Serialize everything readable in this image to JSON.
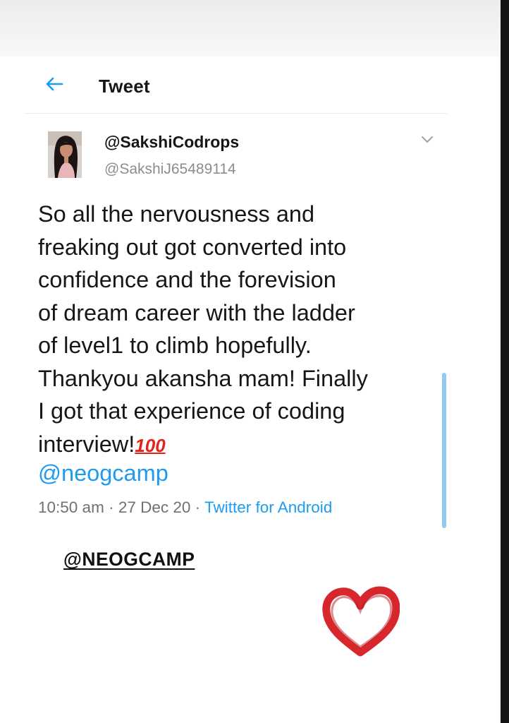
{
  "header": {
    "title": "Tweet"
  },
  "tweet": {
    "display_name": "@SakshiCodrops",
    "handle": "@SakshiJ65489114",
    "text_lines": [
      "So all the nervousness and",
      "freaking out got converted into",
      "confidence and the forevision",
      "of dream career with the ladder",
      "of level1 to climb hopefully.",
      "Thankyou akansha mam! Finally",
      "I got that experience of coding"
    ],
    "last_line": "interview!",
    "emoji": "💯",
    "emoji_text": "100",
    "mention": "@neogcamp",
    "time": "10:50 am",
    "separator": " · ",
    "date": "27 Dec 20",
    "source": "Twitter for Android"
  },
  "overlay": {
    "handle": "@NEOGCAMP"
  },
  "colors": {
    "link": "#1d9bf0",
    "heart": "#d8262d",
    "scroll_indicator": "#91cbef"
  },
  "icons": {
    "back": "arrow-left-icon",
    "menu": "chevron-down-icon",
    "sticker": "heart-icon"
  }
}
